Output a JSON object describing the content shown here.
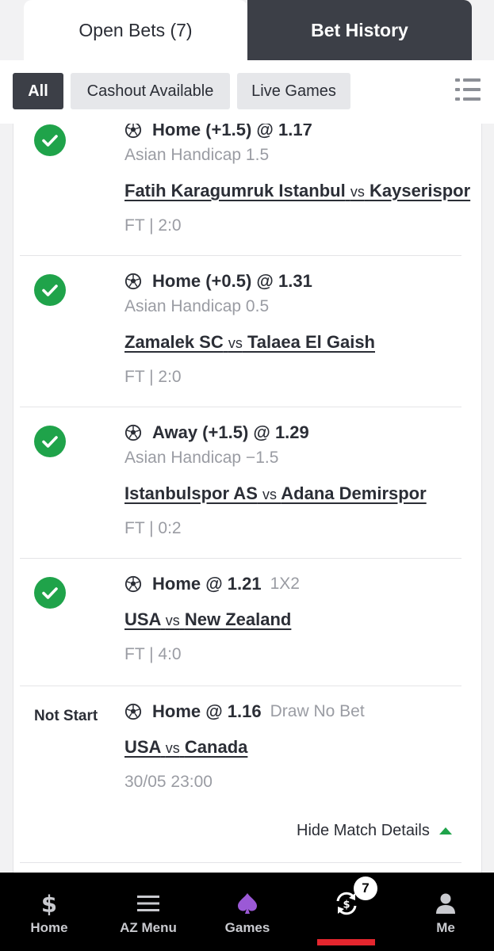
{
  "tabs": [
    {
      "label": "Open Bets (7)",
      "active": true
    },
    {
      "label": "Bet History",
      "active": false
    }
  ],
  "filters": [
    {
      "label": "All",
      "active": true
    },
    {
      "label": "Cashout Available",
      "active": false
    },
    {
      "label": "Live Games",
      "active": false
    }
  ],
  "bets": [
    {
      "status": "won",
      "selection": "Home (+1.5) @ 1.17",
      "market": "Asian Handicap 1.5",
      "home": "Fatih Karagumruk Istanbul",
      "vs": "vs",
      "away": "Kayserispor",
      "result": "FT | 2:0"
    },
    {
      "status": "won",
      "selection": "Home (+0.5) @ 1.31",
      "market": "Asian Handicap 0.5",
      "home": "Zamalek SC",
      "vs": "vs",
      "away": "Talaea El Gaish",
      "result": "FT | 2:0"
    },
    {
      "status": "won",
      "selection": "Away (+1.5) @ 1.29",
      "market": "Asian Handicap −1.5",
      "home": "Istanbulspor AS",
      "vs": "vs",
      "away": "Adana Demirspor",
      "result": "FT | 0:2"
    },
    {
      "status": "won",
      "selection": "Home @ 1.21",
      "market": "1X2",
      "home": "USA",
      "vs": "vs",
      "away": "New Zealand",
      "result": "FT | 4:0"
    },
    {
      "status": "Not Start",
      "selection": "Home @ 1.16",
      "market": "Draw No Bet",
      "home": "USA",
      "vs": "vs",
      "away": "Canada",
      "result": "30/05 23:00"
    }
  ],
  "hide_details_label": "Hide Match Details",
  "bottom_nav": [
    {
      "label": "Home",
      "icon": "dollar-s-icon"
    },
    {
      "label": "AZ Menu",
      "icon": "menu-icon"
    },
    {
      "label": "Games",
      "icon": "spade-icon"
    },
    {
      "label": "",
      "icon": "bets-cycle-icon",
      "badge": "7",
      "active": true
    },
    {
      "label": "Me",
      "icon": "user-icon"
    }
  ],
  "colors": {
    "dark": "#3c3f47",
    "win_green": "#1fa34a",
    "active_red": "#e5262e",
    "muted_text": "#9a9ca3"
  }
}
